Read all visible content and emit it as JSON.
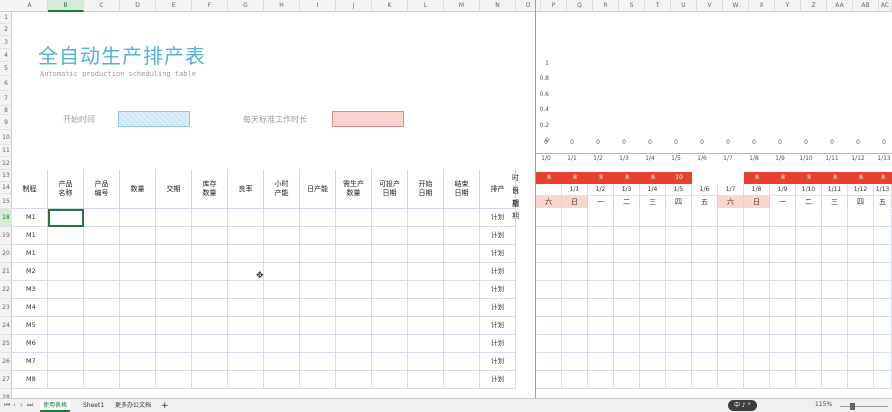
{
  "columns": [
    "A",
    "B",
    "C",
    "D",
    "E",
    "F",
    "G",
    "H",
    "I",
    "J",
    "K",
    "L",
    "M",
    "N",
    "O",
    "P",
    "Q",
    "R",
    "S",
    "T",
    "U",
    "V",
    "W",
    "X",
    "Y",
    "Z",
    "AA",
    "AB",
    "AC"
  ],
  "selected_column": "B",
  "rows": [
    "1",
    "2",
    "3",
    "4",
    "5",
    "6",
    "7",
    "8",
    "9",
    "10",
    "11",
    "12",
    "13",
    "14",
    "15",
    "18",
    "19",
    "20",
    "21",
    "22",
    "23",
    "24",
    "25",
    "26",
    "27",
    "28",
    "29"
  ],
  "selected_row": "18",
  "title": "全自动生产排产表",
  "subtitle": "Automatic production scheduling table",
  "start_time_label": "开始时间",
  "std_hours_label": "每天标准工作时长",
  "chart_data": {
    "type": "bar",
    "y_ticks": [
      "1",
      "0.8",
      "0.6",
      "0.4",
      "0.2",
      "0"
    ],
    "ylim": [
      0,
      1
    ],
    "categories": [
      "1/0",
      "1/1",
      "1/2",
      "1/3",
      "1/4",
      "1/5",
      "1/6",
      "1/7",
      "1/8",
      "1/9",
      "1/10",
      "1/11",
      "1/12",
      "1/13"
    ],
    "values": [
      "0",
      "0",
      "0",
      "0",
      "0",
      "0",
      "0",
      "0",
      "0",
      "0",
      "0",
      "0",
      "0",
      "0"
    ]
  },
  "headers": [
    "制程",
    "产品\n名称",
    "产品\n编号",
    "数量",
    "交期",
    "库存\n数量",
    "良率",
    "小时\n产能",
    "日产能",
    "需生产\n数量",
    "可投产\n日期",
    "开始\n日期",
    "结束\n日期",
    "排产"
  ],
  "right_labels": {
    "duration": "时长",
    "date": "日期",
    "weekday": "星期"
  },
  "durations": [
    "8",
    "8",
    "8",
    "8",
    "8",
    "10",
    "",
    "",
    "8",
    "8",
    "8",
    "8",
    "8",
    "8"
  ],
  "dates": [
    "",
    "1/1",
    "1/2",
    "1/3",
    "1/4",
    "1/5",
    "1/6",
    "1/7",
    "1/8",
    "1/9",
    "1/10",
    "1/11",
    "1/12",
    "1/13"
  ],
  "weekdays": [
    "六",
    "日",
    "一",
    "二",
    "三",
    "四",
    "五",
    "六",
    "日",
    "一",
    "二",
    "三",
    "四",
    "五"
  ],
  "process_rows": [
    "M1",
    "M1",
    "M1",
    "M2",
    "M3",
    "M4",
    "M5",
    "M6",
    "M7",
    "M8",
    "M9",
    ""
  ],
  "plan_label": "计划",
  "sheet_tabs": [
    "使用表格",
    "Sheet1",
    "更多办公文档"
  ],
  "add_tab": "+",
  "ime": "中 ♪ °",
  "zoom": "115%",
  "accent": "#1e7a3c",
  "red": "#e8412f"
}
